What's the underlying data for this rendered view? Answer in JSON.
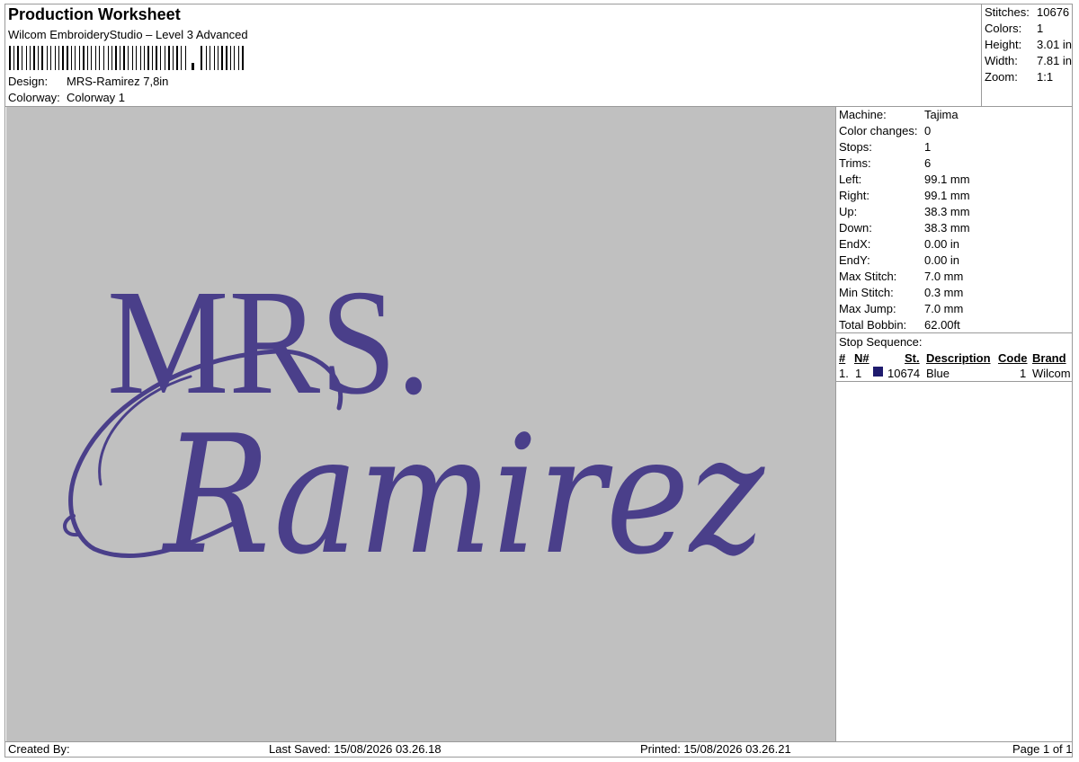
{
  "header": {
    "title": "Production Worksheet",
    "software": "Wilcom EmbroideryStudio – Level 3 Advanced",
    "design_label": "Design:",
    "design_value": "MRS-Ramirez 7,8in",
    "colorway_label": "Colorway:",
    "colorway_value": "Colorway 1"
  },
  "summary": [
    {
      "label": "Stitches:",
      "value": "10676"
    },
    {
      "label": "Colors:",
      "value": "1"
    },
    {
      "label": "Height:",
      "value": "3.01 in"
    },
    {
      "label": "Width:",
      "value": "7.81 in"
    },
    {
      "label": "Zoom:",
      "value": "1:1"
    }
  ],
  "machine_info": [
    {
      "label": "Machine:",
      "value": "Tajima"
    },
    {
      "label": "Color changes:",
      "value": "0"
    },
    {
      "label": "Stops:",
      "value": "1"
    },
    {
      "label": "Trims:",
      "value": "6"
    },
    {
      "label": "Left:",
      "value": "99.1 mm"
    },
    {
      "label": "Right:",
      "value": "99.1 mm"
    },
    {
      "label": "Up:",
      "value": "38.3 mm"
    },
    {
      "label": "Down:",
      "value": "38.3 mm"
    },
    {
      "label": "EndX:",
      "value": "0.00 in"
    },
    {
      "label": "EndY:",
      "value": "0.00 in"
    },
    {
      "label": "Max Stitch:",
      "value": "7.0 mm"
    },
    {
      "label": "Min Stitch:",
      "value": "0.3 mm"
    },
    {
      "label": "Max Jump:",
      "value": "7.0 mm"
    },
    {
      "label": "Total Bobbin:",
      "value": "62.00ft"
    }
  ],
  "stop_sequence": {
    "label": "Stop Sequence:",
    "columns": {
      "num": "#",
      "n": "N#",
      "st": "St.",
      "description": "Description",
      "code": "Code",
      "brand": "Brand"
    },
    "rows": [
      {
        "num": "1.",
        "n": "1",
        "color": "#1f1b6e",
        "st": "10674",
        "description": "Blue",
        "code": "1",
        "brand": "Wilcom"
      }
    ]
  },
  "design_preview": {
    "line1": "MRS.",
    "line2": "Ramirez",
    "thread_color": "#4a3f8a"
  },
  "footer": {
    "created_by": "Created By:",
    "last_saved": "Last Saved: 15/08/2026 03.26.18",
    "printed": "Printed: 15/08/2026 03.26.21",
    "page": "Page 1 of 1"
  }
}
